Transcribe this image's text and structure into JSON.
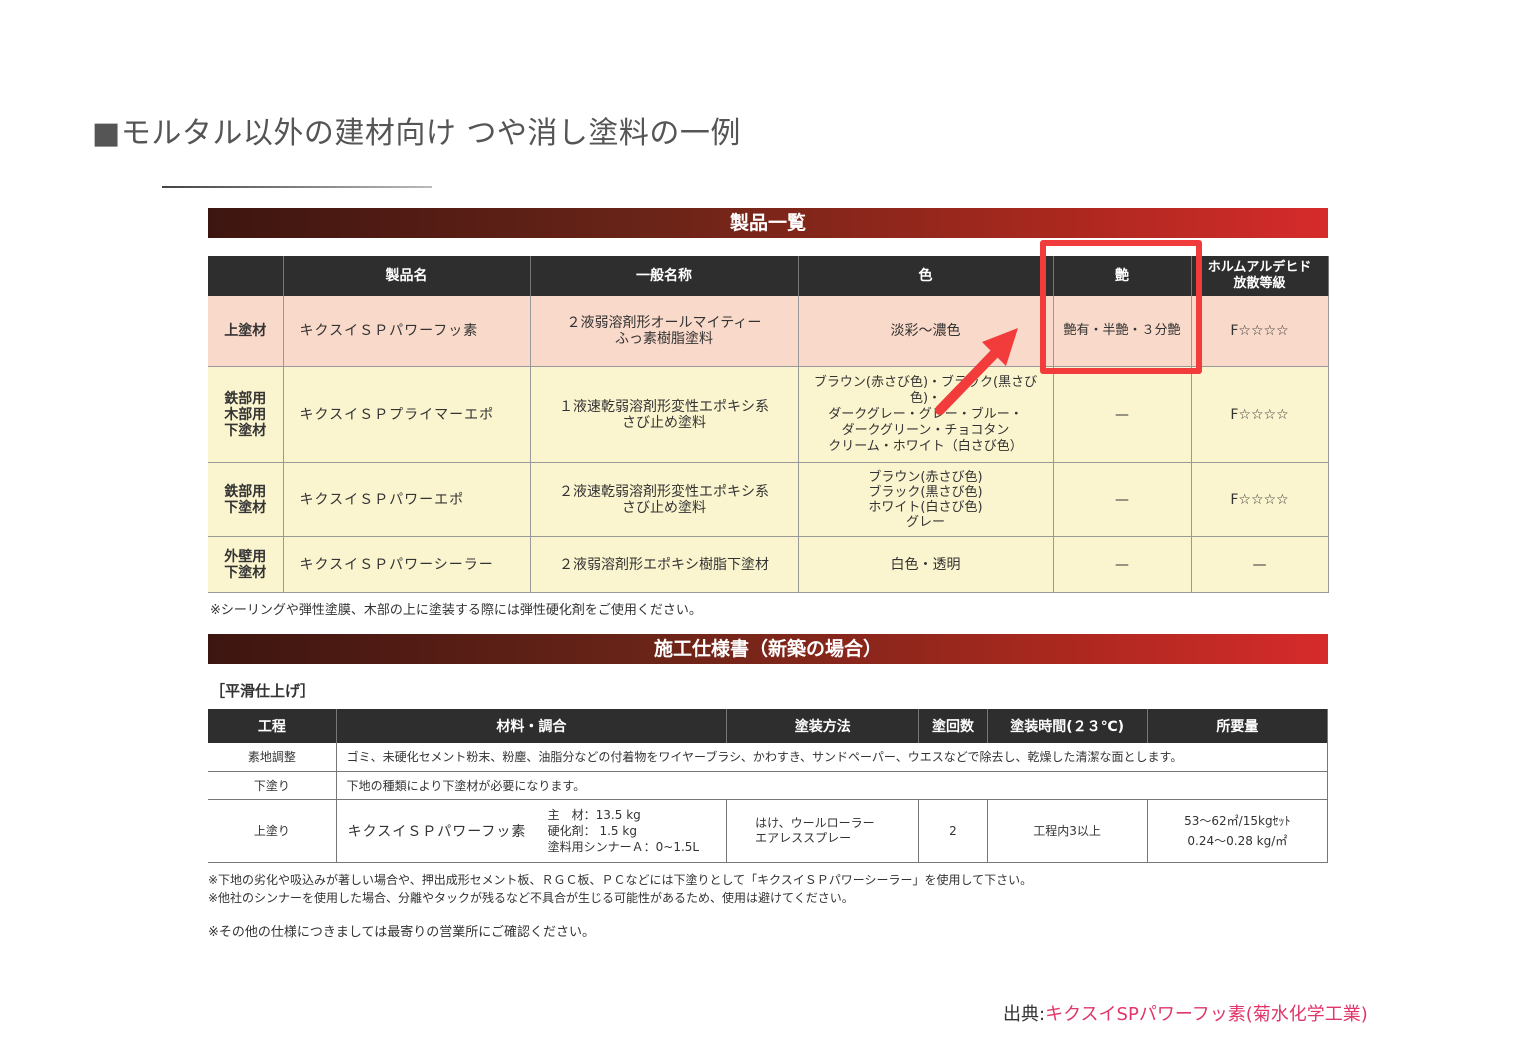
{
  "page_title": "■モルタル以外の建材向け つや消し塗料の一例",
  "section1_banner": "製品一覧",
  "table1": {
    "headers": [
      "",
      "製品名",
      "一般名称",
      "色",
      "艶",
      "ホルムアルデヒド\n放散等級"
    ],
    "rows": [
      {
        "cat": "上塗材",
        "name": "キクスイＳＰパワーフッ素",
        "general": "２液弱溶剤形オールマイティー\nふっ素樹脂塗料",
        "color": "淡彩〜濃色",
        "gloss": "艶有・半艶・３分艶",
        "grade": "F☆☆☆☆"
      },
      {
        "cat": "鉄部用\n木部用\n下塗材",
        "name": "キクスイＳＰプライマーエポ",
        "general": "１液速乾弱溶剤形変性エポキシ系\nさび止め塗料",
        "color": "ブラウン(赤さび色)・ブラック(黒さび色)・\nダークグレー・グレー・ブルー・\nダークグリーン・チョコタン\nクリーム・ホワイト（白さび色）",
        "gloss": "—",
        "grade": "F☆☆☆☆"
      },
      {
        "cat": "鉄部用\n下塗材",
        "name": "キクスイＳＰパワーエポ",
        "general": "２液速乾弱溶剤形変性エポキシ系\nさび止め塗料",
        "color": "ブラウン(赤さび色)\nブラック(黒さび色)\nホワイト(白さび色)\nグレー",
        "gloss": "—",
        "grade": "F☆☆☆☆"
      },
      {
        "cat": "外壁用\n下塗材",
        "name": "キクスイＳＰパワーシーラー",
        "general": "２液弱溶剤形エポキシ樹脂下塗材",
        "color": "白色・透明",
        "gloss": "—",
        "grade": "—"
      }
    ],
    "note": "※シーリングや弾性塗膜、木部の上に塗装する際には弾性硬化剤をご使用ください。"
  },
  "section2_banner": "施工仕様書（新築の場合）",
  "subheading": "［平滑仕上げ］",
  "table2": {
    "headers": [
      "工程",
      "材料・調合",
      "塗装方法",
      "塗回数",
      "塗装時間(２３℃)",
      "所要量"
    ],
    "row1": {
      "step": "素地調整",
      "text": "ゴミ、未硬化セメント粉末、粉塵、油脂分などの付着物をワイヤーブラシ、かわすき、サンドペーパー、ウエスなどで除去し、乾燥した清潔な面とします。"
    },
    "row2": {
      "step": "下塗り",
      "text": "下地の種類により下塗材が必要になります。"
    },
    "row3": {
      "step": "上塗り",
      "product": "キクスイＳＰパワーフッ素",
      "comp": [
        "主　材：13.5 kg",
        "硬化剤：  1.5 kg",
        "塗料用シンナーＡ：0~1.5L"
      ],
      "method": "はけ、ウールローラー\nエアレススプレー",
      "coats": "2",
      "interval": "工程内3以上",
      "amount": "53〜62㎡/15kgｾｯﾄ\n0.24〜0.28 kg/㎡"
    }
  },
  "footnote1": "※下地の劣化や吸込みが著しい場合や、押出成形セメント板、ＲＧＣ板、ＰＣなどには下塗りとして「キクスイＳＰパワーシーラー」を使用して下さい。",
  "footnote2": "※他社のシンナーを使用した場合、分離やタックが残るなど不具合が生じる可能性があるため、使用は避けてください。",
  "footnote3": "※その他の仕様につきましては最寄りの営業所にご確認ください。",
  "source_prefix": "出典:",
  "source_link": "キクスイSPパワーフッ素(菊水化学工業)",
  "colors": {
    "highlight": "#f23c3c",
    "link": "#e0366a"
  }
}
